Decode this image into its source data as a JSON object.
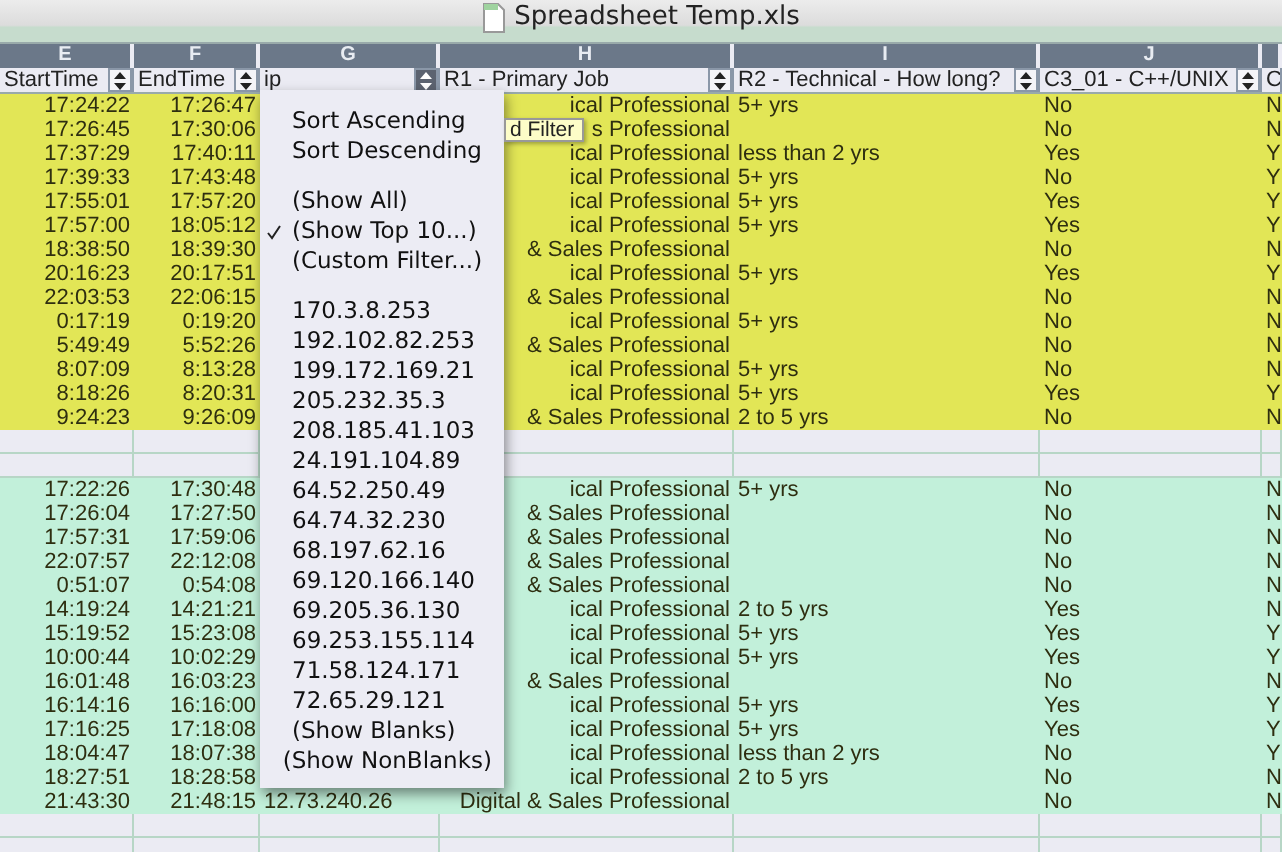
{
  "window": {
    "title": "Spreadsheet Temp.xls"
  },
  "columns": [
    {
      "letter": "E",
      "header": "StartTime",
      "filter_button": {
        "open": false
      }
    },
    {
      "letter": "F",
      "header": "EndTime",
      "filter_button": {
        "open": false
      }
    },
    {
      "letter": "G",
      "header": "ip",
      "filter_button": {
        "open": true
      }
    },
    {
      "letter": "H",
      "header": "R1 - Primary Job",
      "filter_button": {
        "open": false
      }
    },
    {
      "letter": "I",
      "header": "R2 - Technical - How long?",
      "filter_button": {
        "open": false
      }
    },
    {
      "letter": "J",
      "header": "C3_01 - C++/UNIX",
      "filter_button": {
        "open": false
      }
    },
    {
      "header": "C"
    }
  ],
  "rows": [
    {
      "kind": "data",
      "color": "#e2e656",
      "cells": [
        "17:24:22",
        "17:26:47",
        null,
        "ical Professional",
        "5+ yrs",
        "No",
        "N"
      ]
    },
    {
      "kind": "data",
      "color": "#e2e656",
      "cells": [
        "17:26:45",
        "17:30:06",
        null,
        "s Professional",
        null,
        "No",
        "N"
      ]
    },
    {
      "kind": "data",
      "color": "#e2e656",
      "cells": [
        "17:37:29",
        "17:40:11",
        null,
        "ical Professional",
        "less than 2 yrs",
        "Yes",
        "Y"
      ]
    },
    {
      "kind": "data",
      "color": "#e2e656",
      "cells": [
        "17:39:33",
        "17:43:48",
        null,
        "ical Professional",
        "5+ yrs",
        "No",
        "Y"
      ]
    },
    {
      "kind": "data",
      "color": "#e2e656",
      "cells": [
        "17:55:01",
        "17:57:20",
        null,
        "ical Professional",
        "5+ yrs",
        "Yes",
        "Y"
      ]
    },
    {
      "kind": "data",
      "color": "#e2e656",
      "cells": [
        "17:57:00",
        "18:05:12",
        null,
        "ical Professional",
        "5+ yrs",
        "Yes",
        "Y"
      ]
    },
    {
      "kind": "data",
      "color": "#e2e656",
      "cells": [
        "18:38:50",
        "18:39:30",
        null,
        "& Sales Professional",
        null,
        "No",
        "N"
      ]
    },
    {
      "kind": "data",
      "color": "#e2e656",
      "cells": [
        "20:16:23",
        "20:17:51",
        null,
        "ical Professional",
        "5+ yrs",
        "Yes",
        "Y"
      ]
    },
    {
      "kind": "data",
      "color": "#e2e656",
      "cells": [
        "22:03:53",
        "22:06:15",
        null,
        "& Sales Professional",
        null,
        "No",
        "N"
      ]
    },
    {
      "kind": "data",
      "color": "#e2e656",
      "cells": [
        "0:17:19",
        "0:19:20",
        null,
        "ical Professional",
        "5+ yrs",
        "No",
        "N"
      ]
    },
    {
      "kind": "data",
      "color": "#e2e656",
      "cells": [
        "5:49:49",
        "5:52:26",
        null,
        "& Sales Professional",
        null,
        "No",
        "N"
      ]
    },
    {
      "kind": "data",
      "color": "#e2e656",
      "cells": [
        "8:07:09",
        "8:13:28",
        null,
        "ical Professional",
        "5+ yrs",
        "No",
        "N"
      ]
    },
    {
      "kind": "data",
      "color": "#e2e656",
      "cells": [
        "8:18:26",
        "8:20:31",
        null,
        "ical Professional",
        "5+ yrs",
        "Yes",
        "Y"
      ]
    },
    {
      "kind": "data",
      "color": "#e2e656",
      "cells": [
        "9:24:23",
        "9:26:09",
        null,
        "& Sales Professional",
        "2 to 5 yrs",
        "No",
        "N"
      ]
    },
    {
      "kind": "blank"
    },
    {
      "kind": "blank"
    },
    {
      "kind": "data",
      "color": "#c2f0da",
      "cells": [
        "17:22:26",
        "17:30:48",
        null,
        "ical Professional",
        "5+ yrs",
        "No",
        "N"
      ]
    },
    {
      "kind": "data",
      "color": "#c2f0da",
      "cells": [
        "17:26:04",
        "17:27:50",
        null,
        "& Sales Professional",
        null,
        "No",
        "N"
      ]
    },
    {
      "kind": "data",
      "color": "#c2f0da",
      "cells": [
        "17:57:31",
        "17:59:06",
        null,
        "& Sales Professional",
        null,
        "No",
        "N"
      ]
    },
    {
      "kind": "data",
      "color": "#c2f0da",
      "cells": [
        "22:07:57",
        "22:12:08",
        null,
        "& Sales Professional",
        null,
        "No",
        "N"
      ]
    },
    {
      "kind": "data",
      "color": "#c2f0da",
      "cells": [
        "0:51:07",
        "0:54:08",
        null,
        "& Sales Professional",
        null,
        "No",
        "N"
      ]
    },
    {
      "kind": "data",
      "color": "#c2f0da",
      "cells": [
        "14:19:24",
        "14:21:21",
        null,
        "ical Professional",
        "2 to 5 yrs",
        "Yes",
        "N"
      ]
    },
    {
      "kind": "data",
      "color": "#c2f0da",
      "cells": [
        "15:19:52",
        "15:23:08",
        null,
        "ical Professional",
        "5+ yrs",
        "Yes",
        "Y"
      ]
    },
    {
      "kind": "data",
      "color": "#c2f0da",
      "cells": [
        "10:00:44",
        "10:02:29",
        null,
        "ical Professional",
        "5+ yrs",
        "Yes",
        "Y"
      ]
    },
    {
      "kind": "data",
      "color": "#c2f0da",
      "cells": [
        "16:01:48",
        "16:03:23",
        null,
        "& Sales Professional",
        null,
        "No",
        "N"
      ]
    },
    {
      "kind": "data",
      "color": "#c2f0da",
      "cells": [
        "16:14:16",
        "16:16:00",
        null,
        "ical Professional",
        "5+ yrs",
        "Yes",
        "Y"
      ]
    },
    {
      "kind": "data",
      "color": "#c2f0da",
      "cells": [
        "17:16:25",
        "17:18:08",
        null,
        "ical Professional",
        "5+ yrs",
        "Yes",
        "Y"
      ]
    },
    {
      "kind": "data",
      "color": "#c2f0da",
      "cells": [
        "18:04:47",
        "18:07:38",
        null,
        "ical Professional",
        "less than 2 yrs",
        "No",
        "Y"
      ]
    },
    {
      "kind": "data",
      "color": "#c2f0da",
      "cells": [
        "18:27:51",
        "18:28:58",
        null,
        "ical Professional",
        "2 to 5 yrs",
        "No",
        "N"
      ]
    },
    {
      "kind": "data",
      "color": "#c2f0da",
      "cells": [
        "21:43:30",
        "21:48:15",
        "12.73.240.26",
        "Digital & Sales Professional",
        null,
        "No",
        "N"
      ]
    },
    {
      "kind": "blank"
    },
    {
      "kind": "blank"
    }
  ],
  "filter_menu": {
    "items": [
      {
        "kind": "item",
        "label": "Sort Ascending",
        "selected": false
      },
      {
        "kind": "item",
        "label": "Sort Descending",
        "selected": false
      },
      {
        "kind": "separator"
      },
      {
        "kind": "item",
        "label": "(Show All)",
        "selected": false
      },
      {
        "kind": "item",
        "label": "(Show Top 10...)",
        "selected": true
      },
      {
        "kind": "item",
        "label": "(Custom Filter...)",
        "selected": false
      },
      {
        "kind": "separator"
      },
      {
        "kind": "item",
        "label": "170.3.8.253",
        "selected": false
      },
      {
        "kind": "item",
        "label": "192.102.82.253",
        "selected": false
      },
      {
        "kind": "item",
        "label": "199.172.169.21",
        "selected": false
      },
      {
        "kind": "item",
        "label": "205.232.35.3",
        "selected": false
      },
      {
        "kind": "item",
        "label": "208.185.41.103",
        "selected": false
      },
      {
        "kind": "item",
        "label": "24.191.104.89",
        "selected": false
      },
      {
        "kind": "item",
        "label": "64.52.250.49",
        "selected": false
      },
      {
        "kind": "item",
        "label": "64.74.32.230",
        "selected": false
      },
      {
        "kind": "item",
        "label": "68.197.62.16",
        "selected": false
      },
      {
        "kind": "item",
        "label": "69.120.166.140",
        "selected": false
      },
      {
        "kind": "item",
        "label": "69.205.36.130",
        "selected": false
      },
      {
        "kind": "item",
        "label": "69.253.155.114",
        "selected": false
      },
      {
        "kind": "item",
        "label": "71.58.124.171",
        "selected": false
      },
      {
        "kind": "item",
        "label": "72.65.29.121",
        "selected": false
      },
      {
        "kind": "item",
        "label": "(Show Blanks)",
        "selected": false
      },
      {
        "kind": "item",
        "label": "(Show NonBlanks)",
        "selected": false
      }
    ]
  },
  "tooltip": {
    "text": "d Filter"
  }
}
